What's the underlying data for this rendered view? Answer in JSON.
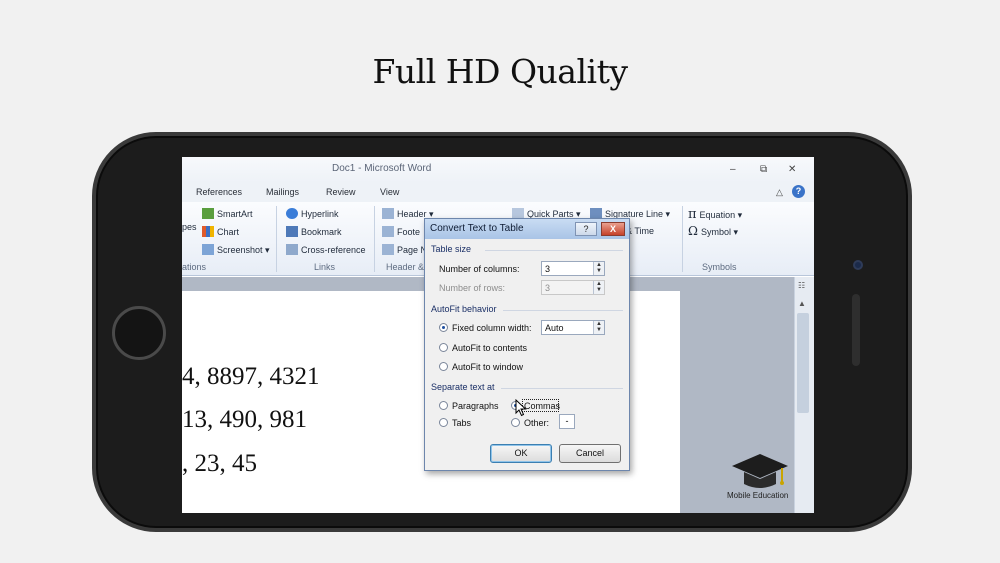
{
  "headline": "Full HD Quality",
  "word": {
    "title": "Doc1  -  Microsoft Word",
    "tabs": [
      "References",
      "Mailings",
      "Review",
      "View"
    ],
    "ribbon": {
      "illustrations_partial": "pes",
      "smartart": "SmartArt",
      "chart": "Chart",
      "screenshot": "Screenshot",
      "group_illustrations_partial": "ations",
      "hyperlink": "Hyperlink",
      "bookmark": "Bookmark",
      "cross_reference": "Cross-reference",
      "group_links": "Links",
      "header": "Header",
      "footer_partial": "Foote",
      "page_partial": "Page N",
      "group_header_partial": "Header &",
      "quick_parts": "Quick Parts",
      "signature_line": "Signature Line",
      "time_partial": "& Time",
      "equation": "Equation",
      "symbol": "Symbol",
      "group_symbols": "Symbols"
    },
    "document_lines": [
      "4, 8897, 4321",
      "13, 490, 981",
      ", 23, 45"
    ],
    "logo_text": "Mobile Education"
  },
  "dialog": {
    "title": "Convert Text to Table",
    "help": "?",
    "close": "X",
    "table_size_label": "Table size",
    "columns_label": "Number of columns:",
    "columns_value": "3",
    "rows_label": "Number of rows:",
    "rows_value": "3",
    "autofit_label": "AutoFit behavior",
    "fixed_label": "Fixed column width:",
    "fixed_value": "Auto",
    "autofit_contents": "AutoFit to contents",
    "autofit_window": "AutoFit to window",
    "separate_label": "Separate text at",
    "paragraphs": "Paragraphs",
    "commas": "Commas",
    "tabs": "Tabs",
    "other": "Other:",
    "other_value": "-",
    "ok": "OK",
    "cancel": "Cancel"
  }
}
